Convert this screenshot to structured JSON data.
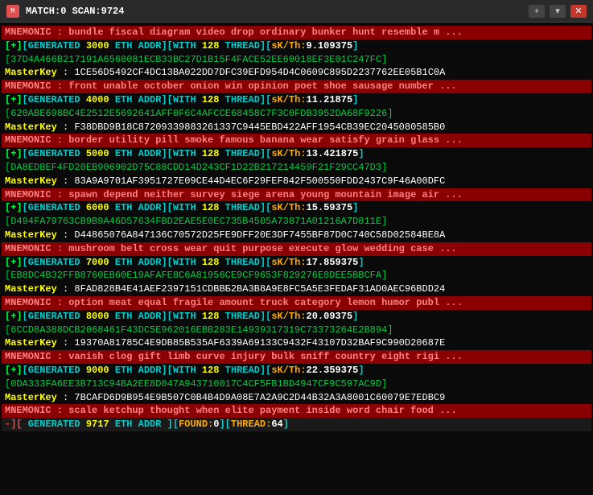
{
  "titleBar": {
    "icon": "M",
    "title": "MATCH:0 SCAN:9724",
    "addBtn": "+",
    "dropBtn": "▾",
    "closeBtn": "✕"
  },
  "lines": [
    {
      "type": "mnemonic",
      "text": "MNEMONIC : bundle fiscal diagram video drop ordinary bunker hunt resemble m ..."
    },
    {
      "type": "generated",
      "gen": "3000",
      "addr": "ETH ADDR",
      "with": "128",
      "thread": "THREAD",
      "sk": "9.109375"
    },
    {
      "type": "addr",
      "text": "37D4A466B217191A6568081ECB33BC27D1B15F4FACE52EE60018EF3E01C247FC"
    },
    {
      "type": "masterkey",
      "label": "MasterKey",
      "text": "1CE56D5492CF4DC13BA022DD7DFC39EFD954D4C0609C895D2237762EE05B1C0A"
    },
    {
      "type": "mnemonic",
      "text": "MNEMONIC : front unable october onion win opinion poet shoe sausage number ..."
    },
    {
      "type": "generated",
      "gen": "4000",
      "addr": "ETH ADDR",
      "with": "128",
      "thread": "THREAD",
      "sk": "11.21875"
    },
    {
      "type": "addr",
      "text": "620ABE698BC4E2512E5692641AFF0F6C4AFCCE68458C7F3C0FDB3952DA68F9226"
    },
    {
      "type": "masterkey",
      "label": "MasterKey",
      "text": "F38DBD9B18C87209339883261337C9445EBD422AFF1954CB39EC2045080585B0"
    },
    {
      "type": "mnemonic",
      "text": "MNEMONIC : border utility pill smoke famous banana wear satisfy grain glass ..."
    },
    {
      "type": "generated",
      "gen": "5000",
      "addr": "ETH ADDR",
      "with": "128",
      "thread": "THREAD",
      "sk": "13.421875"
    },
    {
      "type": "addr",
      "text": "DA8EDBEF4FD20EB906902D75C88CDD14D243CF1D22B217214459F21F29CC47D3"
    },
    {
      "type": "masterkey",
      "label": "MasterKey",
      "text": "83A9A9701AF3951727E09CE44D4EC6F29FEF842F500550FDD2437C9F46A00DFC"
    },
    {
      "type": "mnemonic",
      "text": "MNEMONIC : spawn depend neither survey siege arena young mountain image air ..."
    },
    {
      "type": "generated",
      "gen": "6000",
      "addr": "ETH ADDR",
      "with": "128",
      "thread": "THREAD",
      "sk": "15.59375"
    },
    {
      "type": "addr",
      "text": "D494FA79763CB9B9A46D57634FBD2EAE5E0EC735B4505A73871A01216A7D811E"
    },
    {
      "type": "masterkey",
      "label": "MasterKey",
      "text": "D44865076A847136C70572D25FE9DFF20E3DF7455BF87D0C740C58D02584BE8A"
    },
    {
      "type": "mnemonic",
      "text": "MNEMONIC : mushroom belt cross wear quit purpose execute glow wedding case ..."
    },
    {
      "type": "generated",
      "gen": "7000",
      "addr": "ETH ADDR",
      "with": "128",
      "thread": "THREAD",
      "sk": "17.859375"
    },
    {
      "type": "addr",
      "text": "EB8DC4B32FFB8760EB60E19AFAFE8C6A81956CE9CF9653F829276E8DEE5BBCFA"
    },
    {
      "type": "masterkey",
      "label": "MasterKey",
      "text": "8FAD828B4E41AEF2397151CDBBБ2BA3B8A9E8FC5A5E3FEDAF31AD0AEC96BDD24"
    },
    {
      "type": "mnemonic",
      "text": "MNEMONIC : option meat equal fragile amount truck category lemon humor publ ..."
    },
    {
      "type": "generated",
      "gen": "8000",
      "addr": "ETH ADDR",
      "with": "128",
      "thread": "THREAD",
      "sk": "20.09375"
    },
    {
      "type": "addr",
      "text": "6CCD8A388DCB2068461F43DC5E962016EBB283E14939317319C73373264E2B894"
    },
    {
      "type": "masterkey",
      "label": "MasterKey",
      "text": "19370A81785C4E9DB85B535AF6339A69133C9432F43107D32BAF9C990D20687E"
    },
    {
      "type": "mnemonic",
      "text": "MNEMONIC : vanish clog gift limb curve injury bulk sniff country eight rigi ..."
    },
    {
      "type": "generated",
      "gen": "9000",
      "addr": "ETH ADDR",
      "with": "128",
      "thread": "THREAD",
      "sk": "22.359375"
    },
    {
      "type": "addr",
      "text": "0DA333FA6EE3B713C94BA2EE8D047A943710017C4CF5FB1BD4947CF9C597AC9D"
    },
    {
      "type": "masterkey",
      "label": "MasterKey",
      "text": "7BCAFD6D9B954E9B507C0B4B4D9A08E7A2A9C2D44B32A3A8001C60079E7EDBC9"
    },
    {
      "type": "mnemonic",
      "text": "MNEMONIC : scale ketchup thought when elite payment inside word chair food ..."
    },
    {
      "type": "status",
      "text": "-][ GENERATED 9717 ETH ADDR ][FOUND:0][THREAD:64"
    }
  ],
  "status": {
    "generated": "9717",
    "found": "0",
    "thread": "64"
  }
}
